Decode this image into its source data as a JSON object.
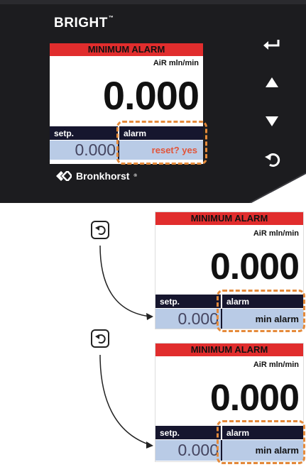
{
  "device": {
    "brand": "BRIGHT",
    "brand_mark": "™",
    "logo_text": "Bronkhorst",
    "logo_mark": "®",
    "buttons": [
      {
        "name": "enter-icon",
        "glyph": "↵"
      },
      {
        "name": "up-arrow-icon",
        "glyph": "▲"
      },
      {
        "name": "down-arrow-icon",
        "glyph": "▼"
      },
      {
        "name": "back-icon",
        "glyph": "↶"
      }
    ]
  },
  "screens": [
    {
      "header": "MINIMUM ALARM",
      "unit": "AiR mln/min",
      "reading": "0.000",
      "setpoint_label": "setp.",
      "setpoint_value": "0.000",
      "alarm_label": "alarm",
      "alarm_value": "reset? yes"
    },
    {
      "header": "MINIMUM ALARM",
      "unit": "AiR mln/min",
      "reading": "0.000",
      "setpoint_label": "setp.",
      "setpoint_value": "0.000",
      "alarm_label": "alarm",
      "alarm_value": "min alarm"
    },
    {
      "header": "MINIMUM ALARM",
      "unit": "AiR mln/min",
      "reading": "0.000",
      "setpoint_label": "setp.",
      "setpoint_value": "0.000",
      "alarm_label": "alarm",
      "alarm_value": "min alarm"
    }
  ],
  "colors": {
    "device_body": "#1c1c1f",
    "device_edge": "#303034",
    "header_red": "#e12d2d",
    "label_bar": "#16162e",
    "value_box": "#b9cbe6",
    "reset_text": "#e2553a",
    "highlight_dash": "#e58a3a"
  }
}
